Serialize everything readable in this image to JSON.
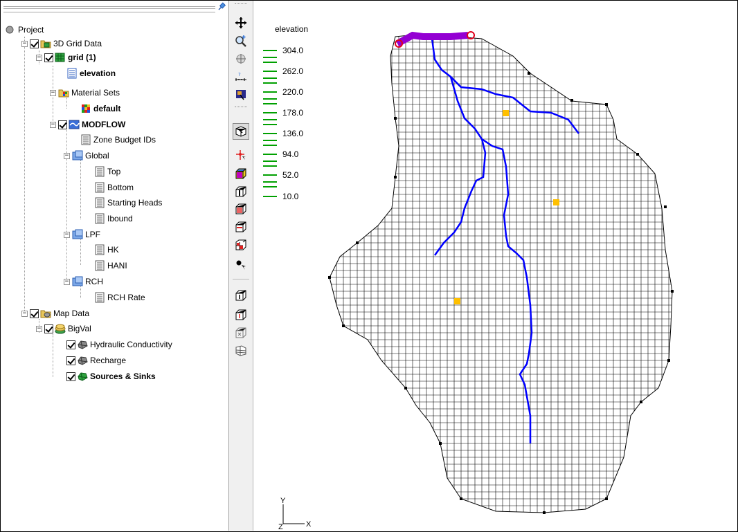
{
  "tree": {
    "items": [
      {
        "label": "Project",
        "bold": false
      },
      {
        "label": "3D Grid Data",
        "bold": false
      },
      {
        "label": "grid (1)",
        "bold": true
      },
      {
        "label": "elevation",
        "bold": true
      },
      {
        "label": "Material Sets",
        "bold": false
      },
      {
        "label": "default",
        "bold": true
      },
      {
        "label": "MODFLOW",
        "bold": true
      },
      {
        "label": "Zone Budget IDs",
        "bold": false
      },
      {
        "label": "Global",
        "bold": false
      },
      {
        "label": "Top",
        "bold": false
      },
      {
        "label": "Bottom",
        "bold": false
      },
      {
        "label": "Starting Heads",
        "bold": false
      },
      {
        "label": "Ibound",
        "bold": false
      },
      {
        "label": "LPF",
        "bold": false
      },
      {
        "label": "HK",
        "bold": false
      },
      {
        "label": "HANI",
        "bold": false
      },
      {
        "label": "RCH",
        "bold": false
      },
      {
        "label": "RCH Rate",
        "bold": false
      },
      {
        "label": "Map Data",
        "bold": false
      },
      {
        "label": "BigVal",
        "bold": false
      },
      {
        "label": "Hydraulic Conductivity",
        "bold": false
      },
      {
        "label": "Recharge",
        "bold": false
      },
      {
        "label": "Sources & Sinks",
        "bold": true
      }
    ]
  },
  "legend": {
    "title": "elevation",
    "values": [
      "304.0",
      "262.0",
      "220.0",
      "178.0",
      "136.0",
      "94.0",
      "52.0",
      "10.0"
    ],
    "color": "#00a000"
  },
  "axes": {
    "y": "Y",
    "z": "Z",
    "x": "X"
  },
  "toolbar": {
    "buttons": [
      "pan-icon",
      "zoom-icon",
      "rotate-icon",
      "measure-icon",
      "frame-icon",
      "select-cells-icon",
      "select-point-icon",
      "cube-icon",
      "cube-i-icon",
      "cube-j-icon",
      "cube-k-icon",
      "grid-icon",
      "select-vertex-icon",
      "create-cell-icon",
      "edit-cell-icon",
      "cell-3d-icon",
      "cell-ortho-icon"
    ]
  },
  "colors": {
    "grid_lines": "#000000",
    "stream_arcs": "#0000ff",
    "seepage": "#9400d3",
    "spring": "#e0001b",
    "wells": "#ffc000",
    "contours": "#cccccc"
  }
}
